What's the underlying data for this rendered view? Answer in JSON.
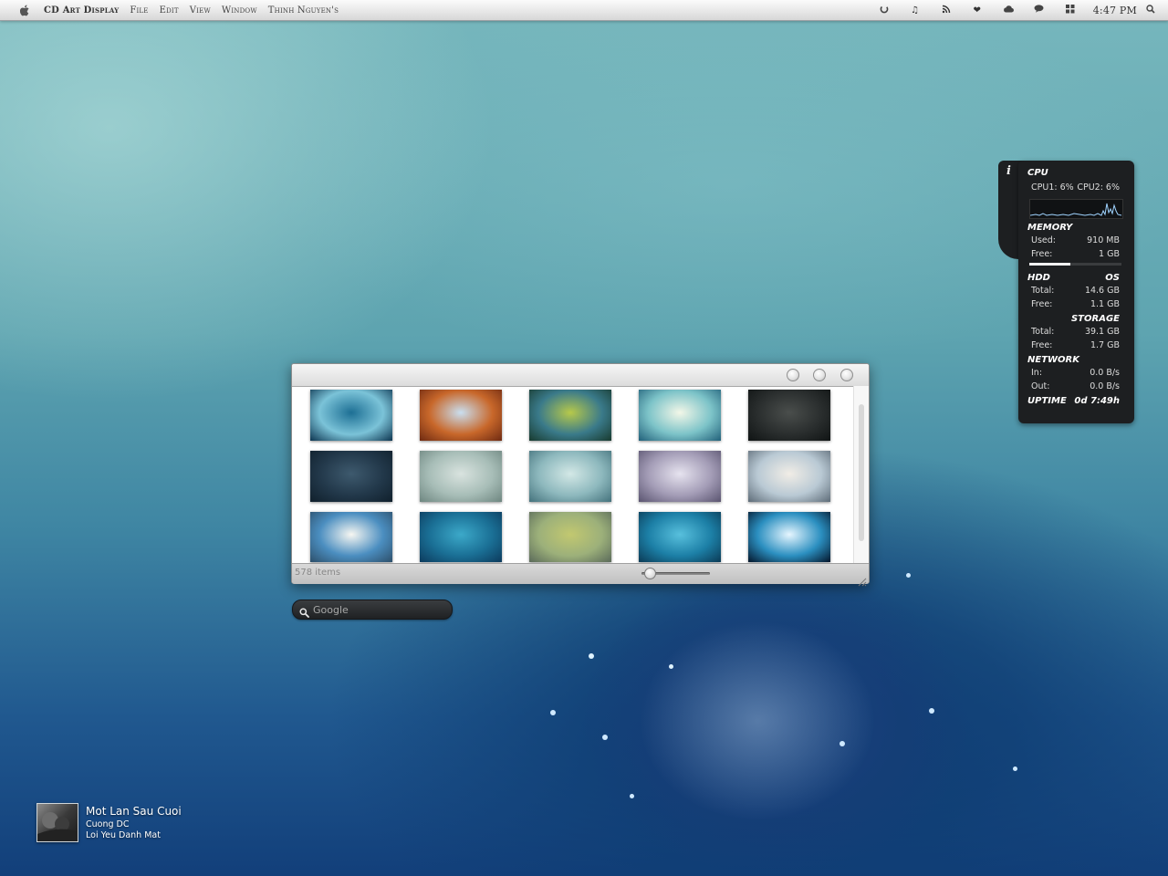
{
  "menubar": {
    "app_name": "CD Art Display",
    "menus": [
      "File",
      "Edit",
      "View",
      "Window",
      "Thinh Nguyen's"
    ],
    "status_icons": [
      "spinner-icon",
      "music-note-icon",
      "rss-icon",
      "heart-icon",
      "cloud-icon",
      "chat-bubble-icon",
      "grid-icon"
    ],
    "clock": "4:47 PM"
  },
  "stats": {
    "cpu_label": "CPU",
    "cpu1": "CPU1: 6%",
    "cpu2": "CPU2: 6%",
    "memory_label": "MEMORY",
    "mem_used_label": "Used:",
    "mem_used": "910 MB",
    "mem_free_label": "Free:",
    "mem_free": "1 GB",
    "mem_used_fraction": 0.45,
    "hdd_label": "HDD",
    "os_label": "OS",
    "os_total_label": "Total:",
    "os_total": "14.6 GB",
    "os_free_label": "Free:",
    "os_free": "1.1 GB",
    "storage_label": "STORAGE",
    "storage_total_label": "Total:",
    "storage_total": "39.1 GB",
    "storage_free_label": "Free:",
    "storage_free": "1.7 GB",
    "network_label": "NETWORK",
    "net_in_label": "In:",
    "net_in": "0.0 B/s",
    "net_out_label": "Out:",
    "net_out": "0.0 B/s",
    "uptime_label": "UPTIME",
    "uptime": "0d 7:49h"
  },
  "window": {
    "item_count": "578 items",
    "zoom_fraction": 0.05,
    "thumbnails": [
      {
        "name": "blue-streaks",
        "colors": [
          "#1d6f94",
          "#7bc3d8",
          "#0d3550"
        ]
      },
      {
        "name": "autumn-leaves",
        "colors": [
          "#c9dff0",
          "#c8672a",
          "#6e2a12"
        ]
      },
      {
        "name": "green-bokeh-frog",
        "colors": [
          "#b7c94a",
          "#3a7a8a",
          "#183a2e"
        ]
      },
      {
        "name": "pale-teal-glow",
        "colors": [
          "#f3f7e8",
          "#7cc3c8",
          "#21607a"
        ]
      },
      {
        "name": "dark-rings",
        "colors": [
          "#4a4e4c",
          "#2a2e2e",
          "#101414"
        ]
      },
      {
        "name": "blue-door",
        "colors": [
          "#3e5a6e",
          "#22384a",
          "#10202c"
        ]
      },
      {
        "name": "grey-teal-vignette",
        "colors": [
          "#d9e3df",
          "#a7bdb7",
          "#6e8680"
        ]
      },
      {
        "name": "soft-teal-vignette",
        "colors": [
          "#d3e8e6",
          "#8db8bd",
          "#44727c"
        ]
      },
      {
        "name": "lavender-vignette",
        "colors": [
          "#e6e3ef",
          "#a39cb6",
          "#5a5470"
        ]
      },
      {
        "name": "cherry-blossoms",
        "colors": [
          "#f1ede6",
          "#b9c9d4",
          "#5e6c78"
        ]
      },
      {
        "name": "white-flowers-sky",
        "colors": [
          "#f7f7f2",
          "#4b8ec0",
          "#2d4f6a"
        ]
      },
      {
        "name": "blue-waves",
        "colors": [
          "#3ca9c9",
          "#1a6f95",
          "#0c3a5c"
        ]
      },
      {
        "name": "yellow-leaves",
        "colors": [
          "#c2c870",
          "#9cb07a",
          "#5a6a5a"
        ]
      },
      {
        "name": "blue-bird-flower",
        "colors": [
          "#58c0dd",
          "#1c7fa6",
          "#0b3a55"
        ]
      },
      {
        "name": "blue-light-burst",
        "colors": [
          "#e6f6ff",
          "#2b8fc0",
          "#04152a"
        ]
      }
    ]
  },
  "search": {
    "placeholder": "Google"
  },
  "now_playing": {
    "title": "Mot Lan Sau Cuoi",
    "artist": "Cuong DC",
    "album": "Loi Yeu Danh Mat"
  }
}
